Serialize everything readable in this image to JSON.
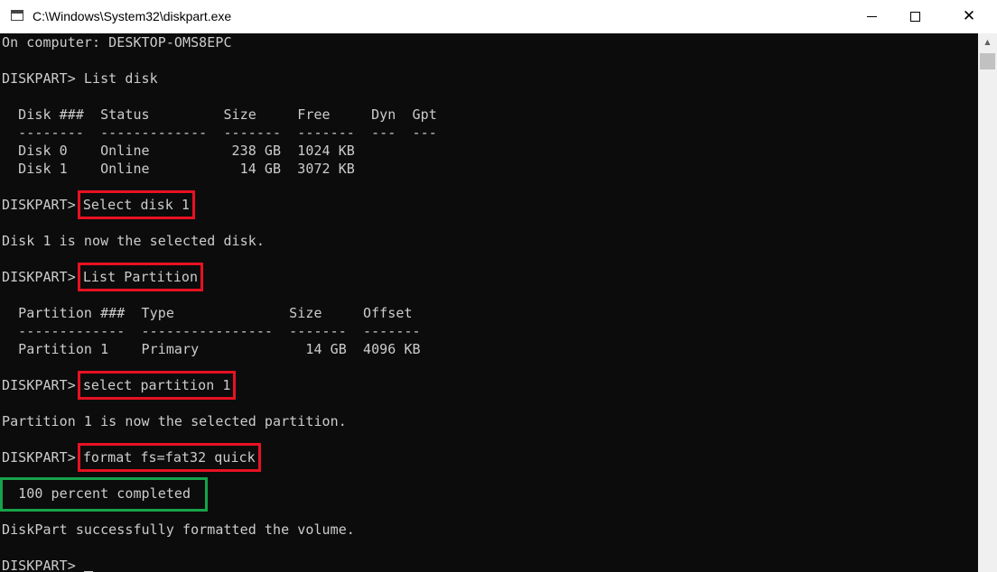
{
  "window": {
    "title": "C:\\Windows\\System32\\diskpart.exe",
    "minimize_glyph": "",
    "close_glyph": "✕"
  },
  "console": {
    "lines": [
      "On computer: DESKTOP-OMS8EPC",
      "",
      "DISKPART> List disk",
      "",
      "  Disk ###  Status         Size     Free     Dyn  Gpt",
      "  --------  -------------  -------  -------  ---  ---",
      "  Disk 0    Online          238 GB  1024 KB",
      "  Disk 1    Online           14 GB  3072 KB",
      "",
      "DISKPART>",
      "",
      "Disk 1 is now the selected disk.",
      "",
      "DISKPART>",
      "",
      "  Partition ###  Type              Size     Offset",
      "  -------------  ----------------  -------  -------",
      "  Partition 1    Primary             14 GB  4096 KB",
      "",
      "DISKPART>",
      "",
      "Partition 1 is now the selected partition.",
      "",
      "DISKPART>",
      "",
      "  100 percent completed",
      "",
      "DiskPart successfully formatted the volume.",
      "",
      "DISKPART> "
    ],
    "highlighted_commands": {
      "select_disk": "Select disk 1",
      "list_partition": "List Partition",
      "select_partition": "select partition 1",
      "format": "format fs=fat32 quick"
    },
    "highlight_colors": {
      "command": "#e81123",
      "success": "#16a34a"
    }
  },
  "scrollbar": {
    "up_arrow_glyph": "▲"
  }
}
